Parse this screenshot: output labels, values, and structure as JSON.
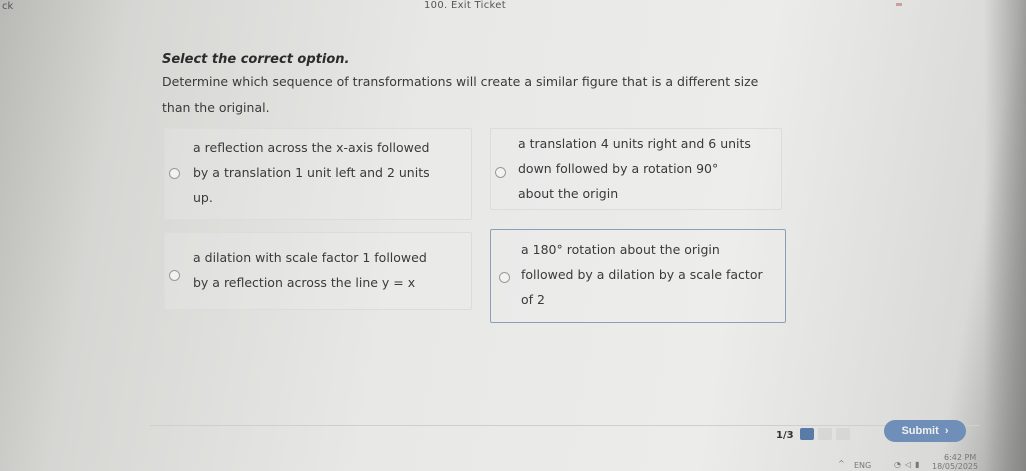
{
  "topbar": {
    "back_label": "ck",
    "window_title": "100. Exit Ticket"
  },
  "instruction": "Select the correct option.",
  "question": "Determine which sequence of transformations will create a similar figure that is a different size than the original.",
  "options": [
    {
      "label": "a reflection across the x-axis followed\nby a translation 1 unit left and 2 units\nup.",
      "selected": false
    },
    {
      "label": "a translation 4 units right and 6 units\ndown followed by a rotation 90°\nabout the origin",
      "selected": false
    },
    {
      "label": "a dilation with scale factor 1 followed\nby a reflection across the line y = x",
      "selected": false
    },
    {
      "label": "a 180° rotation about the origin\nfollowed by a dilation by a scale factor\nof 2",
      "selected": true
    }
  ],
  "footer": {
    "progress": "1/3",
    "progress_fraction": 0.333,
    "submit_label": "Submit",
    "submit_icon": "chevron-right-icon",
    "accent_color": "#6f8fb8"
  },
  "taskbar": {
    "lang": "ENG",
    "time": "6:42 PM",
    "date": "18/05/2025"
  }
}
